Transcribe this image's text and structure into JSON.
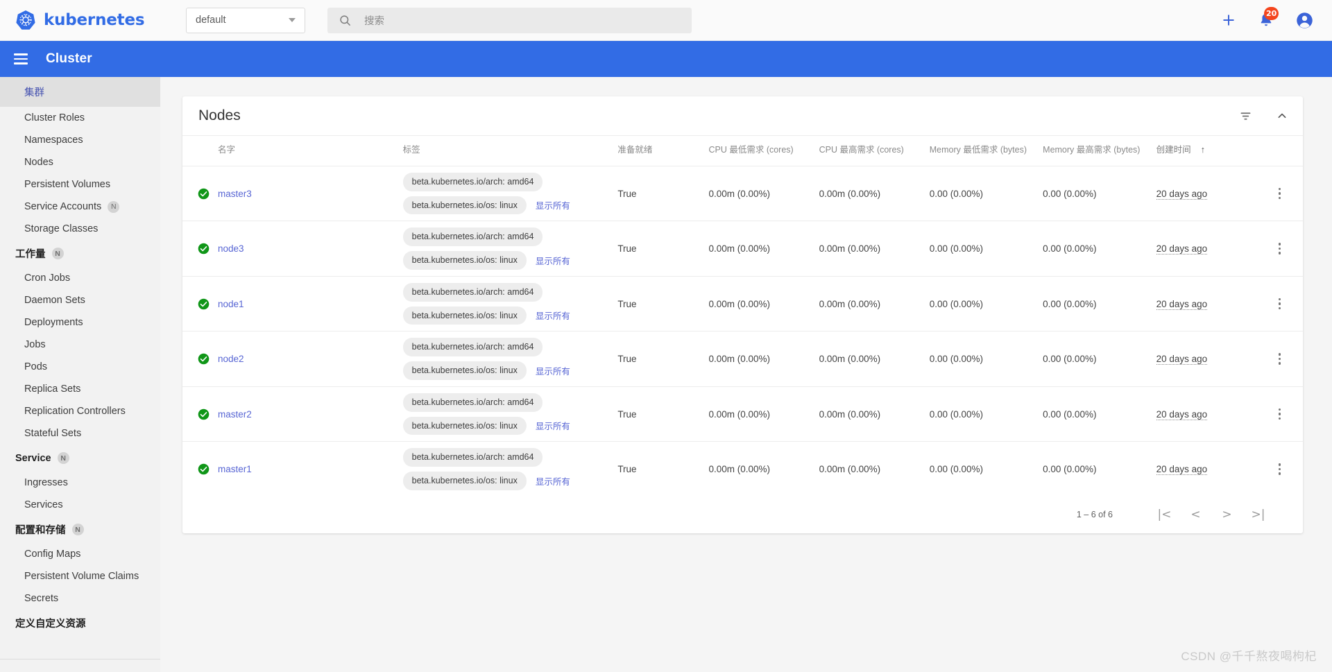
{
  "topbar": {
    "brand": "kubernetes",
    "namespace_value": "default",
    "search_placeholder": "搜索",
    "add_label": "+",
    "notification_count": "20"
  },
  "header": {
    "title": "Cluster"
  },
  "sidebar": {
    "groups": [
      {
        "title": "集群",
        "active": true,
        "badge": "",
        "items": [
          {
            "label": "Cluster Roles"
          },
          {
            "label": "Namespaces"
          },
          {
            "label": "Nodes"
          },
          {
            "label": "Persistent Volumes"
          },
          {
            "label": "Service Accounts",
            "badge": "N"
          },
          {
            "label": "Storage Classes"
          }
        ]
      },
      {
        "title": "工作量",
        "badge": "N",
        "items": [
          {
            "label": "Cron Jobs"
          },
          {
            "label": "Daemon Sets"
          },
          {
            "label": "Deployments"
          },
          {
            "label": "Jobs"
          },
          {
            "label": "Pods"
          },
          {
            "label": "Replica Sets"
          },
          {
            "label": "Replication Controllers"
          },
          {
            "label": "Stateful Sets"
          }
        ]
      },
      {
        "title": "Service",
        "badge": "N",
        "items": [
          {
            "label": "Ingresses"
          },
          {
            "label": "Services"
          }
        ]
      },
      {
        "title": "配置和存储",
        "badge": "N",
        "items": [
          {
            "label": "Config Maps"
          },
          {
            "label": "Persistent Volume Claims"
          },
          {
            "label": "Secrets"
          }
        ]
      },
      {
        "title": "定义自定义资源",
        "badge": "",
        "items": []
      }
    ]
  },
  "card": {
    "title": "Nodes"
  },
  "table": {
    "columns": [
      {
        "key": "status",
        "label": ""
      },
      {
        "key": "name",
        "label": "名字"
      },
      {
        "key": "labels",
        "label": "标签"
      },
      {
        "key": "ready",
        "label": "准备就绪"
      },
      {
        "key": "cpu_min",
        "label": "CPU 最低需求 (cores)"
      },
      {
        "key": "cpu_max",
        "label": "CPU 最高需求 (cores)"
      },
      {
        "key": "mem_min",
        "label": "Memory 最低需求 (bytes)"
      },
      {
        "key": "mem_max",
        "label": "Memory 最高需求 (bytes)"
      },
      {
        "key": "created",
        "label": "创建时间"
      },
      {
        "key": "menu",
        "label": ""
      }
    ],
    "sorted_column": "创建时间",
    "sort_direction": "↑",
    "show_all_label": "显示所有",
    "rows": [
      {
        "status": "ok",
        "name": "master3",
        "labels": [
          "beta.kubernetes.io/arch: amd64",
          "beta.kubernetes.io/os: linux"
        ],
        "ready": "True",
        "cpu_min": "0.00m (0.00%)",
        "cpu_max": "0.00m (0.00%)",
        "mem_min": "0.00 (0.00%)",
        "mem_max": "0.00 (0.00%)",
        "created": "20 days ago"
      },
      {
        "status": "ok",
        "name": "node3",
        "labels": [
          "beta.kubernetes.io/arch: amd64",
          "beta.kubernetes.io/os: linux"
        ],
        "ready": "True",
        "cpu_min": "0.00m (0.00%)",
        "cpu_max": "0.00m (0.00%)",
        "mem_min": "0.00 (0.00%)",
        "mem_max": "0.00 (0.00%)",
        "created": "20 days ago"
      },
      {
        "status": "ok",
        "name": "node1",
        "labels": [
          "beta.kubernetes.io/arch: amd64",
          "beta.kubernetes.io/os: linux"
        ],
        "ready": "True",
        "cpu_min": "0.00m (0.00%)",
        "cpu_max": "0.00m (0.00%)",
        "mem_min": "0.00 (0.00%)",
        "mem_max": "0.00 (0.00%)",
        "created": "20 days ago"
      },
      {
        "status": "ok",
        "name": "node2",
        "labels": [
          "beta.kubernetes.io/arch: amd64",
          "beta.kubernetes.io/os: linux"
        ],
        "ready": "True",
        "cpu_min": "0.00m (0.00%)",
        "cpu_max": "0.00m (0.00%)",
        "mem_min": "0.00 (0.00%)",
        "mem_max": "0.00 (0.00%)",
        "created": "20 days ago"
      },
      {
        "status": "ok",
        "name": "master2",
        "labels": [
          "beta.kubernetes.io/arch: amd64",
          "beta.kubernetes.io/os: linux"
        ],
        "ready": "True",
        "cpu_min": "0.00m (0.00%)",
        "cpu_max": "0.00m (0.00%)",
        "mem_min": "0.00 (0.00%)",
        "mem_max": "0.00 (0.00%)",
        "created": "20 days ago"
      },
      {
        "status": "ok",
        "name": "master1",
        "labels": [
          "beta.kubernetes.io/arch: amd64",
          "beta.kubernetes.io/os: linux"
        ],
        "ready": "True",
        "cpu_min": "0.00m (0.00%)",
        "cpu_max": "0.00m (0.00%)",
        "mem_min": "0.00 (0.00%)",
        "mem_max": "0.00 (0.00%)",
        "created": "20 days ago"
      }
    ]
  },
  "pagination": {
    "range": "1 – 6 of 6",
    "first": "|<",
    "prev": "<",
    "next": ">",
    "last": ">|"
  },
  "watermark": "CSDN @千千熬夜喝枸杞",
  "colors": {
    "brand_blue": "#326ce5",
    "link_blue": "#5765d4",
    "status_green": "#109618",
    "badge_red": "#f4451d"
  }
}
